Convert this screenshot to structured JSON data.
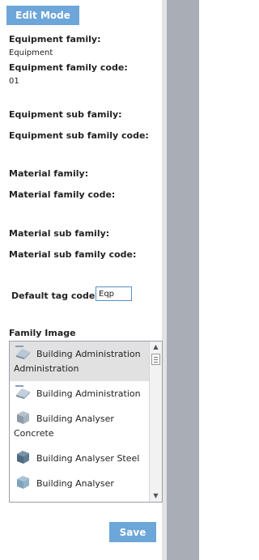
{
  "toolbar": {
    "edit_mode_label": "Edit Mode",
    "save_label": "Save"
  },
  "fields": {
    "equipment_family_label": "Equipment family:",
    "equipment_family_value": "Equipment",
    "equipment_family_code_label": "Equipment family code:",
    "equipment_family_code_value": "01",
    "equipment_sub_family_label": "Equipment sub family:",
    "equipment_sub_family_code_label": "Equipment sub family code:",
    "material_family_label": "Material family:",
    "material_family_code_label": "Material family code:",
    "material_sub_family_label": "Material sub family:",
    "material_sub_family_code_label": "Material sub family code:",
    "default_tag_code_label": "Default tag code:",
    "default_tag_code_value": "Eqp"
  },
  "family_image": {
    "label": "Family Image",
    "items": [
      {
        "label": "Building Administration Administration",
        "icon": "building-admin-thumbnail",
        "selected": true
      },
      {
        "label": "Building Administration",
        "icon": "building-admin-thumbnail",
        "selected": false
      },
      {
        "label": "Building Analyser Concrete",
        "icon": "analyser-concrete-thumbnail",
        "selected": false
      },
      {
        "label": "Building Analyser Steel",
        "icon": "analyser-steel-thumbnail",
        "selected": false
      },
      {
        "label": "Building Analyser",
        "icon": "analyser-thumbnail",
        "selected": false
      }
    ]
  },
  "colors": {
    "accent": "#6da6d8",
    "right_bar": "#a9adb6",
    "selected_row": "#e1e1e1"
  }
}
